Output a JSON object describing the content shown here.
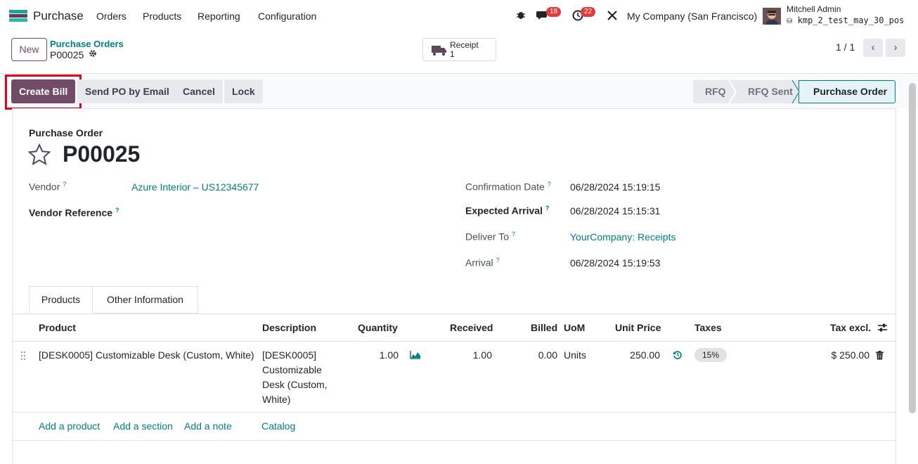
{
  "navbar": {
    "app_name": "Purchase",
    "menus": [
      "Orders",
      "Products",
      "Reporting",
      "Configuration"
    ],
    "messages_count": "18",
    "activities_count": "22",
    "company": "My Company (San Francisco)",
    "user_name": "Mitchell Admin",
    "db_name": "kmp_2_test_may_30_pos"
  },
  "control": {
    "new_label": "New",
    "breadcrumb_parent": "Purchase Orders",
    "breadcrumb_current": "P00025",
    "receipt_label": "Receipt",
    "receipt_count": "1",
    "pager": "1 / 1"
  },
  "actions": {
    "create_bill": "Create Bill",
    "send_po": "Send PO by Email",
    "cancel": "Cancel",
    "lock": "Lock"
  },
  "stages": [
    "RFQ",
    "RFQ Sent",
    "Purchase Order"
  ],
  "form": {
    "doc_type": "Purchase Order",
    "name": "P00025",
    "vendor_label": "Vendor",
    "vendor_value": "Azure Interior – US12345677",
    "vendor_ref_label": "Vendor Reference",
    "confirmation_label": "Confirmation Date",
    "confirmation_value": "06/28/2024 15:19:15",
    "expected_label": "Expected Arrival",
    "expected_value": "06/28/2024 15:15:31",
    "deliver_label": "Deliver To",
    "deliver_value": "YourCompany: Receipts",
    "arrival_label": "Arrival",
    "arrival_value": "06/28/2024 15:19:53",
    "help_mark": "?"
  },
  "tabs": [
    "Products",
    "Other Information"
  ],
  "table": {
    "headers": {
      "product": "Product",
      "description": "Description",
      "quantity": "Quantity",
      "received": "Received",
      "billed": "Billed",
      "uom": "UoM",
      "unit_price": "Unit Price",
      "taxes": "Taxes",
      "tax_excl": "Tax excl."
    },
    "rows": [
      {
        "product": "[DESK0005] Customizable Desk (Custom, White)",
        "description_lines": [
          "[DESK0005]",
          "Customizable",
          "Desk (Custom,",
          "White)"
        ],
        "quantity": "1.00",
        "received": "1.00",
        "billed": "0.00",
        "uom": "Units",
        "unit_price": "250.00",
        "tax": "15%",
        "subtotal": "$ 250.00"
      }
    ],
    "add_links": [
      "Add a product",
      "Add a section",
      "Add a note",
      "Catalog"
    ]
  },
  "colors": {
    "primary": "#714b67",
    "link": "#017e84",
    "badge": "#e33a3a",
    "highlight": "#e0001a"
  }
}
